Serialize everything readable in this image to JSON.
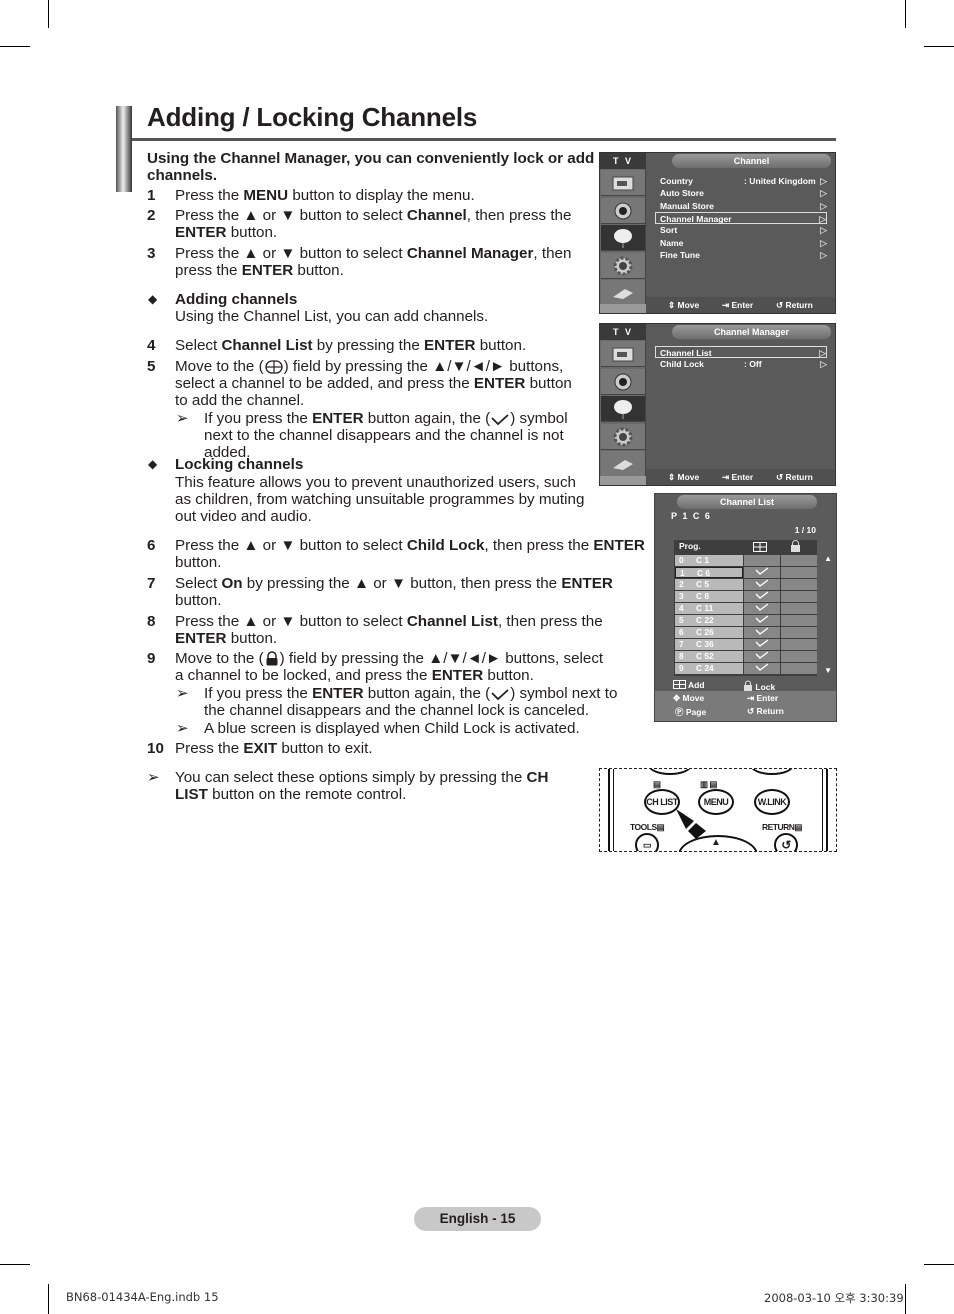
{
  "page": {
    "title": "Adding / Locking Channels",
    "intro": "Using the Channel Manager, you can conveniently lock or add channels."
  },
  "steps": [
    {
      "num": "1",
      "parts": [
        "Press the ",
        "MENU",
        " button to display the menu."
      ]
    },
    {
      "num": "2",
      "parts": [
        "Press the ▲ or ▼ button to select ",
        "Channel",
        ", then press the ",
        "ENTER",
        " button."
      ]
    },
    {
      "num": "3",
      "parts": [
        "Press the ▲ or ▼ button to select ",
        "Channel Manager",
        ", then press the ",
        "ENTER",
        " button."
      ]
    },
    {
      "num": "4",
      "parts": [
        "Select ",
        "Channel List",
        " by pressing the ",
        "ENTER",
        " button."
      ]
    },
    {
      "num": "5",
      "parts": [
        "Move to the (",
        "add-symbol",
        ") field by pressing the ▲/▼/◄/► buttons, select a channel to be added, and press the ",
        "ENTER",
        " button to add the channel."
      ]
    },
    {
      "num": "6",
      "parts": [
        "Press the ▲ or ▼ button to select ",
        "Child Lock",
        ", then press the ",
        "ENTER",
        " button."
      ]
    },
    {
      "num": "7",
      "parts": [
        "Select ",
        "On",
        " by pressing the ▲ or ▼ button, then press the ",
        "ENTER",
        " button."
      ]
    },
    {
      "num": "8",
      "parts": [
        "Press the ▲ or ▼ button to select ",
        "Channel List",
        ", then press the ",
        "ENTER",
        " button."
      ]
    },
    {
      "num": "9",
      "parts": [
        "Move to the (",
        "lock-symbol",
        ") field by pressing the ▲/▼/◄/► buttons, select a channel to be locked, and press the ",
        "ENTER",
        " button."
      ]
    },
    {
      "num": "10",
      "parts": [
        "Press the ",
        "EXIT",
        " button to exit."
      ]
    }
  ],
  "sections": {
    "adding": {
      "heading": "Adding channels",
      "desc": "Using the Channel List, you can add channels."
    },
    "locking": {
      "heading": "Locking channels",
      "desc": "This feature allows you to prevent unauthorized users, such as children, from watching unsuitable programmes by muting out video and audio."
    }
  },
  "notes": {
    "step5_note": [
      "If you press the ",
      "ENTER",
      " button again, the (",
      "check",
      ") symbol next to the channel disappears and the channel is not added."
    ],
    "step9_note1": [
      "If you press the ",
      "ENTER",
      " button again, the (",
      "check",
      ") symbol next to the channel disappears and the channel lock is canceled."
    ],
    "step9_note2": "A blue screen is displayed when Child Lock is activated.",
    "chlist_note": [
      "You can select these options simply by pressing the ",
      "CH LIST",
      " button on the remote control."
    ]
  },
  "osd_channel": {
    "tv_label": "T V",
    "title": "Channel",
    "items": [
      {
        "label": "Country",
        "value": ": United Kingdom",
        "selected": false
      },
      {
        "label": "Auto Store",
        "value": "",
        "selected": false
      },
      {
        "label": "Manual Store",
        "value": "",
        "selected": false
      },
      {
        "label": "Channel Manager",
        "value": "",
        "selected": true
      },
      {
        "label": "Sort",
        "value": "",
        "selected": false
      },
      {
        "label": "Name",
        "value": "",
        "selected": false
      },
      {
        "label": "Fine Tune",
        "value": "",
        "selected": false
      }
    ],
    "footer": {
      "move": "Move",
      "enter": "Enter",
      "return": "Return"
    }
  },
  "osd_manager": {
    "tv_label": "T V",
    "title": "Channel Manager",
    "items": [
      {
        "label": "Channel List",
        "value": "",
        "selected": true
      },
      {
        "label": "Child Lock",
        "value": ": Off",
        "selected": false
      }
    ],
    "footer": {
      "move": "Move",
      "enter": "Enter",
      "return": "Return"
    }
  },
  "channel_list": {
    "title": "Channel List",
    "current": "P 1   C 6",
    "page": "1 / 10",
    "header_prog": "Prog.",
    "rows": [
      {
        "prog": "0",
        "ch": "C 1",
        "added": false,
        "locked": false,
        "selected": false
      },
      {
        "prog": "1",
        "ch": "C 6",
        "added": true,
        "locked": false,
        "selected": true
      },
      {
        "prog": "2",
        "ch": "C 5",
        "added": true,
        "locked": false,
        "selected": false
      },
      {
        "prog": "3",
        "ch": "C 8",
        "added": true,
        "locked": false,
        "selected": false
      },
      {
        "prog": "4",
        "ch": "C 11",
        "added": true,
        "locked": false,
        "selected": false
      },
      {
        "prog": "5",
        "ch": "C 22",
        "added": true,
        "locked": false,
        "selected": false
      },
      {
        "prog": "6",
        "ch": "C 26",
        "added": true,
        "locked": false,
        "selected": false
      },
      {
        "prog": "7",
        "ch": "C 36",
        "added": true,
        "locked": false,
        "selected": false
      },
      {
        "prog": "8",
        "ch": "C 52",
        "added": true,
        "locked": false,
        "selected": false
      },
      {
        "prog": "9",
        "ch": "C 24",
        "added": true,
        "locked": false,
        "selected": false
      }
    ],
    "legend": {
      "add": "Add",
      "lock": "Lock"
    },
    "footer": {
      "move": "Move",
      "enter": "Enter",
      "page": "Page",
      "return": "Return"
    }
  },
  "remote": {
    "buttons": {
      "chlist": "CH LIST",
      "menu": "MENU",
      "wlink": "W.LINK"
    },
    "labels": {
      "tools": "TOOLS",
      "return": "RETURN"
    }
  },
  "footer": {
    "page_label": "English - 15",
    "slug_left": "BN68-01434A-Eng.indb   15",
    "slug_right": "2008-03-10   오후 3:30:39"
  },
  "colors": {
    "osd_bg": "#5a5a5a",
    "page_badge": "#c8c8c8"
  }
}
